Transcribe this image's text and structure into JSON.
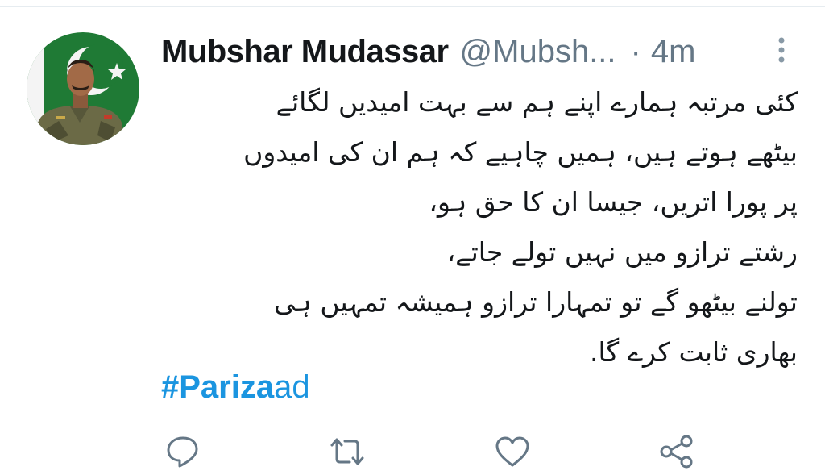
{
  "tweet": {
    "author_name": "Mubshar Mudassar",
    "author_handle": "@Mubsh...",
    "separator": "·",
    "timestamp": "4m",
    "lines": [
      "کئی مرتبہ ہمارے اپنے ہم سے بہت امیدیں لگائے",
      "بیٹھے ہوتے ہیں، ہمیں چاہیے کہ ہم ان کی امیدوں",
      "پر پورا اتریں، جیسا ان کا حق ہو،",
      "رشتے ترازو میں نہیں تولے جاتے،",
      "تولنے بیٹھو گے تو تمہارا ترازو ہمیشہ تمہیں ہی",
      "بھاری ثابت کرے گا."
    ],
    "hashtag_bold": "#Pariza",
    "hashtag_rest": "ad"
  },
  "icons": {
    "more": "more-vertical-icon",
    "reply": "reply-icon",
    "retweet": "retweet-icon",
    "like": "like-icon",
    "share": "share-icon"
  },
  "colors": {
    "text": "#14171a",
    "secondary": "#657786",
    "link": "#1b95e0",
    "icon": "#657786",
    "flag_green": "#01411c"
  }
}
